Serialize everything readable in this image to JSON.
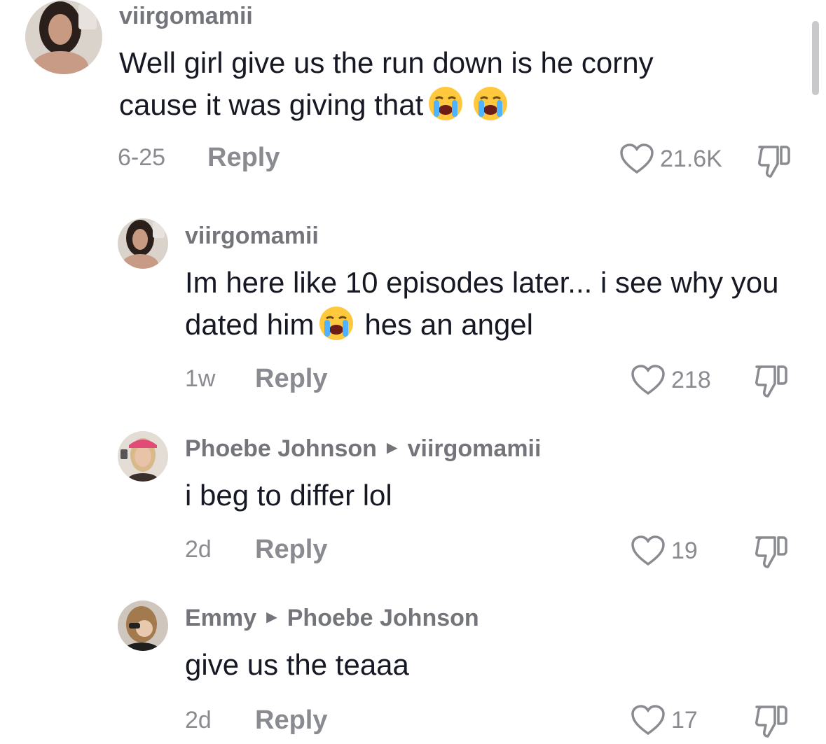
{
  "colors": {
    "text": "#161823",
    "secondary": "#8a8b91",
    "username": "#73757a"
  },
  "comments": [
    {
      "username": "viirgomamii",
      "text_parts": [
        "Well girl give us the run down is he corny cause it was giving that",
        "",
        ""
      ],
      "emojis": [
        "loudly-crying-face",
        "loudly-crying-face"
      ],
      "time": "6-25",
      "reply_label": "Reply",
      "likes": "21.6K"
    },
    {
      "username": "viirgomamii",
      "text_parts": [
        "Im here like 10 episodes later... i see why you dated him",
        "hes an angel"
      ],
      "emojis": [
        "loudly-crying-face"
      ],
      "time": "1w",
      "reply_label": "Reply",
      "likes": "218"
    },
    {
      "username": "Phoebe Johnson",
      "reply_to": "viirgomamii",
      "text": "i beg to differ lol",
      "time": "2d",
      "reply_label": "Reply",
      "likes": "19"
    },
    {
      "username": "Emmy",
      "reply_to": "Phoebe Johnson",
      "text": "give us the teaaa",
      "time": "2d",
      "reply_label": "Reply",
      "likes": "17"
    }
  ]
}
